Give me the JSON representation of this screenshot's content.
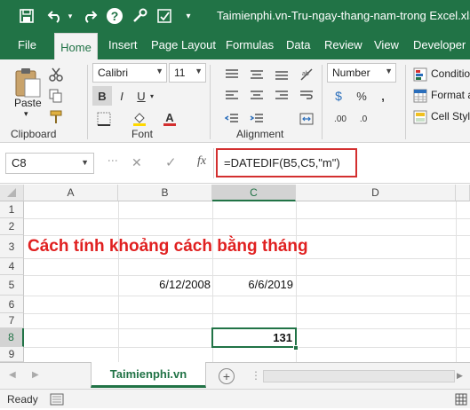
{
  "window": {
    "title": "Taimienphi.vn-Tru-ngay-thang-nam-trong Excel.xlsx"
  },
  "quick_access": {
    "save_icon": "save-icon",
    "undo_icon": "undo-icon",
    "redo_icon": "redo-icon",
    "help_icon": "help-icon",
    "tools_icon": "tools-icon",
    "spell_icon": "spellcheck-icon"
  },
  "tabs": [
    "File",
    "Home",
    "Insert",
    "Page Layout",
    "Formulas",
    "Data",
    "Review",
    "View",
    "Developer"
  ],
  "ribbon": {
    "clipboard": {
      "label": "Clipboard",
      "paste": "Paste"
    },
    "font": {
      "label": "Font",
      "name": "Calibri",
      "size": "11",
      "bold": "B",
      "italic": "I",
      "underline": "U",
      "font_color_glyph": "A"
    },
    "alignment": {
      "label": "Alignment"
    },
    "number": {
      "format": "Number",
      "currency": "$",
      "percent": "%",
      "comma": ",",
      "inc_decimal": ".00",
      "dec_decimal": ".0"
    },
    "styles": {
      "conditional": "Conditio",
      "format_as": "Format a",
      "cell_styles": "Cell Styl"
    }
  },
  "formula_bar": {
    "name_box": "C8",
    "cancel": "✕",
    "enter": "✓",
    "fx": "fx",
    "formula": "=DATEDIF(B5,C5,\"m\")"
  },
  "grid": {
    "columns": [
      "A",
      "B",
      "C",
      "D"
    ],
    "rows": [
      "1",
      "2",
      "3",
      "4",
      "5",
      "6",
      "7",
      "8",
      "9"
    ],
    "title_text": "Cách tính khoảng cách bằng tháng",
    "b5": "6/12/2008",
    "c5": "6/6/2019",
    "c8": "131"
  },
  "sheets": {
    "active": "Taimienphi.vn",
    "add": "+"
  },
  "status": {
    "ready": "Ready"
  },
  "colors": {
    "excel_green": "#217346",
    "accent_red": "#d32f2f",
    "title_red": "#e02020"
  }
}
